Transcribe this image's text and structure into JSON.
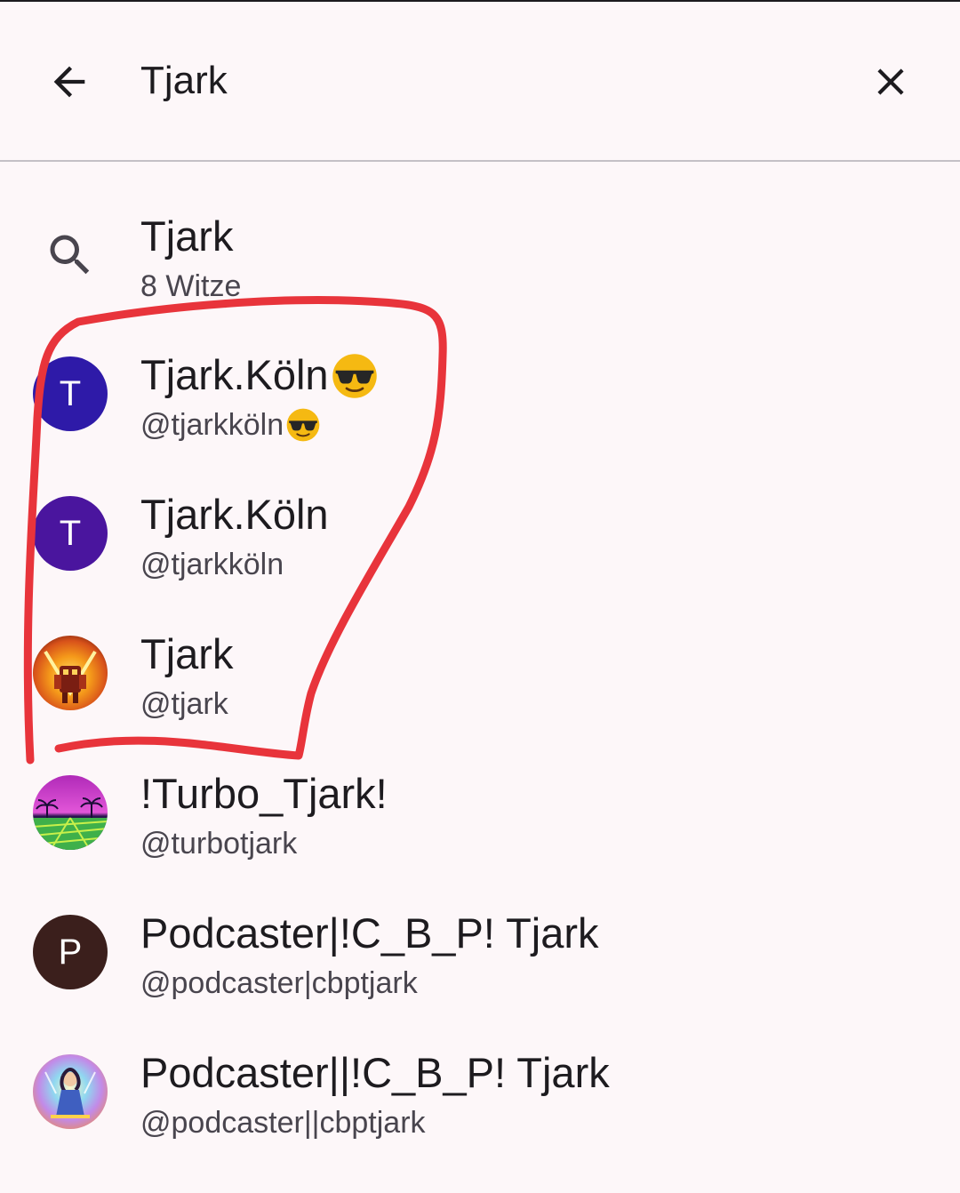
{
  "search": {
    "query": "Tjark",
    "back_label": "Back",
    "clear_label": "Clear"
  },
  "results": [
    {
      "kind": "query",
      "title": "Tjark",
      "subtitle": "8 Witze",
      "icon": "search-icon"
    },
    {
      "kind": "user",
      "title": "Tjark.Köln",
      "title_emoji": "😎",
      "subtitle": "@tjarkköln",
      "subtitle_emoji": "😎",
      "avatar_letter": "T",
      "avatar_color": "#2e1aa8"
    },
    {
      "kind": "user",
      "title": "Tjark.Köln",
      "subtitle": "@tjarkköln",
      "avatar_letter": "T",
      "avatar_color": "#4a159e"
    },
    {
      "kind": "user",
      "title": "Tjark",
      "subtitle": "@tjark",
      "avatar_image": "fiery-robot-avatar"
    },
    {
      "kind": "user",
      "title": "!Turbo_Tjark!",
      "subtitle": "@turbotjark",
      "avatar_image": "synthwave-palm-avatar"
    },
    {
      "kind": "user",
      "title": "Podcaster|!C_B_P! Tjark",
      "subtitle": "@podcaster|cbptjark",
      "avatar_letter": "P",
      "avatar_color": "#3b1f1c"
    },
    {
      "kind": "user",
      "title": "Podcaster||!C_B_P! Tjark",
      "subtitle": "@podcaster||cbptjark",
      "avatar_image": "colorful-figure-avatar"
    }
  ],
  "colors": {
    "background": "#fdf7f9",
    "text_primary": "#1d1b1f",
    "text_secondary": "#49454e",
    "divider": "#c4c0c6",
    "annotation_stroke": "#e8343b"
  }
}
